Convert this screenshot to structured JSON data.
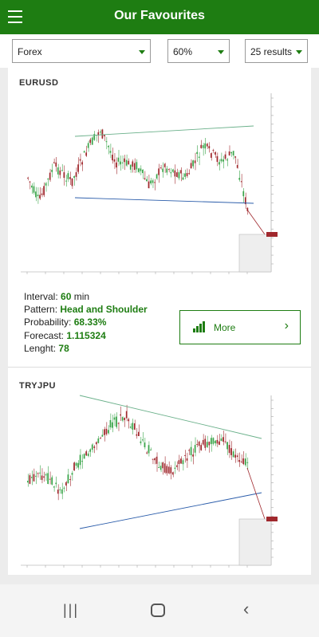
{
  "appbar": {
    "title": "Our Favourites",
    "menu_icon": "hamburger-icon"
  },
  "filters": {
    "market": "Forex",
    "probability": "60%",
    "results": "25 results"
  },
  "cards": [
    {
      "symbol": "EURUSD",
      "interval_label": "Interval:",
      "interval_value": "60",
      "interval_unit": "min",
      "pattern_label": "Pattern:",
      "pattern_value": "Head and Shoulder",
      "probability_label": "Probability:",
      "probability_value": "68.33%",
      "forecast_label": "Forecast:",
      "forecast_value": "1.115324",
      "length_label": "Lenght:",
      "length_value": "78",
      "more_label": "More"
    },
    {
      "symbol": "TRYJPU"
    }
  ],
  "navbar": {
    "recents_icon": "recents-icon",
    "home_icon": "home-icon",
    "back_icon": "back-icon"
  },
  "colors": {
    "brand": "#1e7d12",
    "bull": "#3aa54a",
    "bear": "#a0282d"
  }
}
